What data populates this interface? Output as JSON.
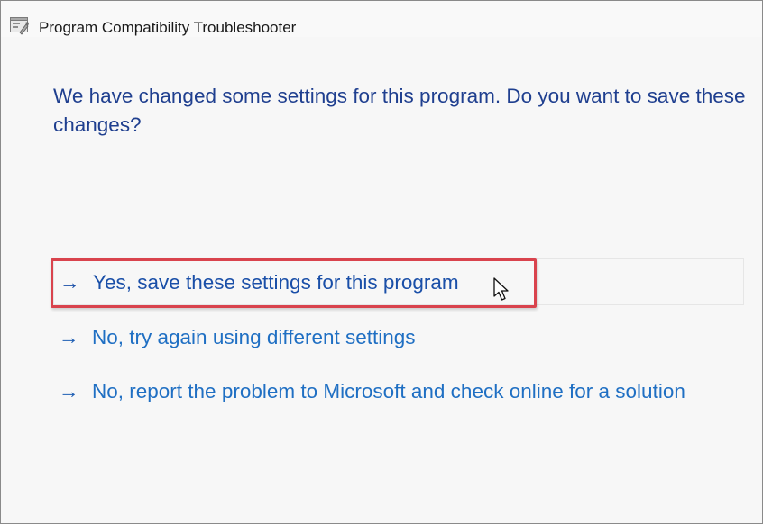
{
  "window": {
    "title": "Program Compatibility Troubleshooter",
    "app_icon": "troubleshooter-app-icon"
  },
  "main": {
    "heading": "We have changed some settings for this program. Do you want to save these changes?",
    "options": [
      {
        "arrow": "→",
        "label": "Yes, save these settings for this program",
        "highlighted": true
      },
      {
        "arrow": "→",
        "label": "No, try again using different settings",
        "highlighted": false
      },
      {
        "arrow": "→",
        "label": "No, report the problem to Microsoft and check online for a solution",
        "highlighted": false
      }
    ]
  },
  "colors": {
    "heading_text": "#1f3f8f",
    "link_text": "#1f6fc3",
    "highlight_border": "#d9434d",
    "window_background": "#f7f7f7"
  },
  "icons": {
    "pointer": "mouse-pointer-icon",
    "arrow": "right-arrow-icon"
  }
}
